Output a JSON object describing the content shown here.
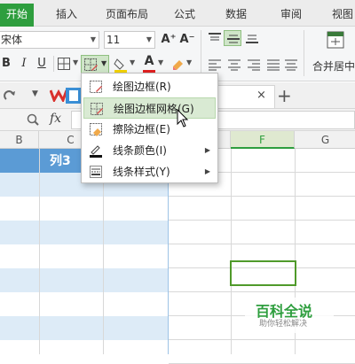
{
  "tabs": [
    "开始",
    "插入",
    "页面布局",
    "公式",
    "数据",
    "审阅",
    "视图"
  ],
  "font": {
    "name": "宋体",
    "size": "11"
  },
  "format_buttons": {
    "bold": "B",
    "italic": "I",
    "underline": "U",
    "grow": "A⁺",
    "shrink": "A⁻",
    "font_color": "A"
  },
  "merge_label": "合并居中",
  "formula_bar": {
    "fx": "fx"
  },
  "columns": [
    "B",
    "C",
    "F",
    "G"
  ],
  "header_cell": "列3",
  "menu": {
    "items": [
      {
        "label": "绘图边框(R)",
        "icon": "draw-border-icon"
      },
      {
        "label": "绘图边框网格(G)",
        "icon": "draw-border-grid-icon"
      },
      {
        "label": "擦除边框(E)",
        "icon": "erase-border-icon"
      },
      {
        "label": "线条颜色(I)",
        "icon": "line-color-icon"
      },
      {
        "label": "线条样式(Y)",
        "icon": "line-style-icon"
      }
    ]
  },
  "watermark": {
    "title": "百科全说",
    "subtitle": "助你轻松解决"
  },
  "colors": {
    "accent": "#2e9e3e",
    "header_fill": "#5b9bd5",
    "band_fill": "#ddebf7",
    "selection": "#4f9a2a"
  }
}
